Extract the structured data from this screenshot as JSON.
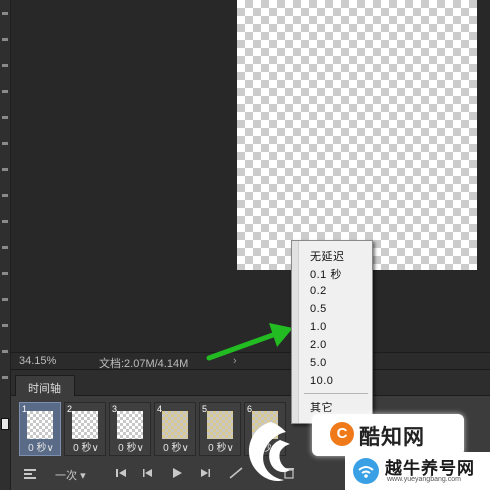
{
  "status": {
    "zoom": "34.15%",
    "doc_info": "文档:2.07M/4.14M",
    "arrow": "›"
  },
  "timeline": {
    "tab_label": "时间轴",
    "frames": [
      {
        "num": "1",
        "delay": "0 秒∨",
        "selected": true
      },
      {
        "num": "2",
        "delay": "0 秒∨"
      },
      {
        "num": "3",
        "delay": "0 秒∨"
      },
      {
        "num": "4",
        "delay": "0 秒∨"
      },
      {
        "num": "5",
        "delay": "0 秒∨"
      },
      {
        "num": "6",
        "delay": "0 秒∨"
      }
    ],
    "loop_label": "一次",
    "loop_arrow": "▾"
  },
  "delay_menu": {
    "items": [
      "无延迟",
      "0.1 秒",
      "0.2",
      "0.5",
      "1.0",
      "2.0",
      "5.0",
      "10.0"
    ],
    "other": "其它"
  },
  "watermark": {
    "brand1": "酷知网",
    "brand2": "越牛养号网",
    "brand2_url": "www.yueyangbang.com"
  },
  "colors": {
    "arrow": "#22bb22",
    "accent_orange": "#f07a1a"
  }
}
